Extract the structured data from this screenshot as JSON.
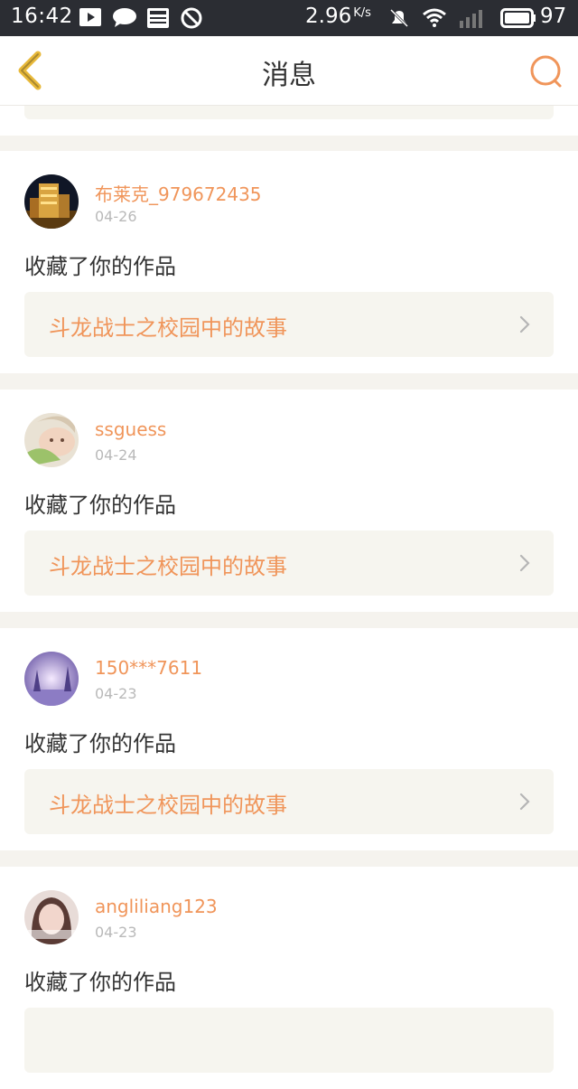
{
  "status_bar": {
    "time": "16:42",
    "speed_value": "2.96",
    "speed_unit": "K/s",
    "battery": "97"
  },
  "nav": {
    "title": "消息",
    "back_icon": "chevron-left-icon",
    "search_icon": "search-icon"
  },
  "colors": {
    "accent": "#f0955a",
    "back_icon": "#e8b93a",
    "link_bg": "#f6f5ef",
    "page_bg": "#f5f3ee"
  },
  "messages": [
    {
      "username": "布莱克_979672435",
      "date": "04-26",
      "action": "收藏了你的作品",
      "work_title": "斗龙战士之校园中的故事"
    },
    {
      "username": "ssguess",
      "date": "04-24",
      "action": "收藏了你的作品",
      "work_title": "斗龙战士之校园中的故事"
    },
    {
      "username": "150***7611",
      "date": "04-23",
      "action": "收藏了你的作品",
      "work_title": "斗龙战士之校园中的故事"
    },
    {
      "username": "angliliang123",
      "date": "04-23",
      "action": "收藏了你的作品",
      "work_title": ""
    }
  ]
}
